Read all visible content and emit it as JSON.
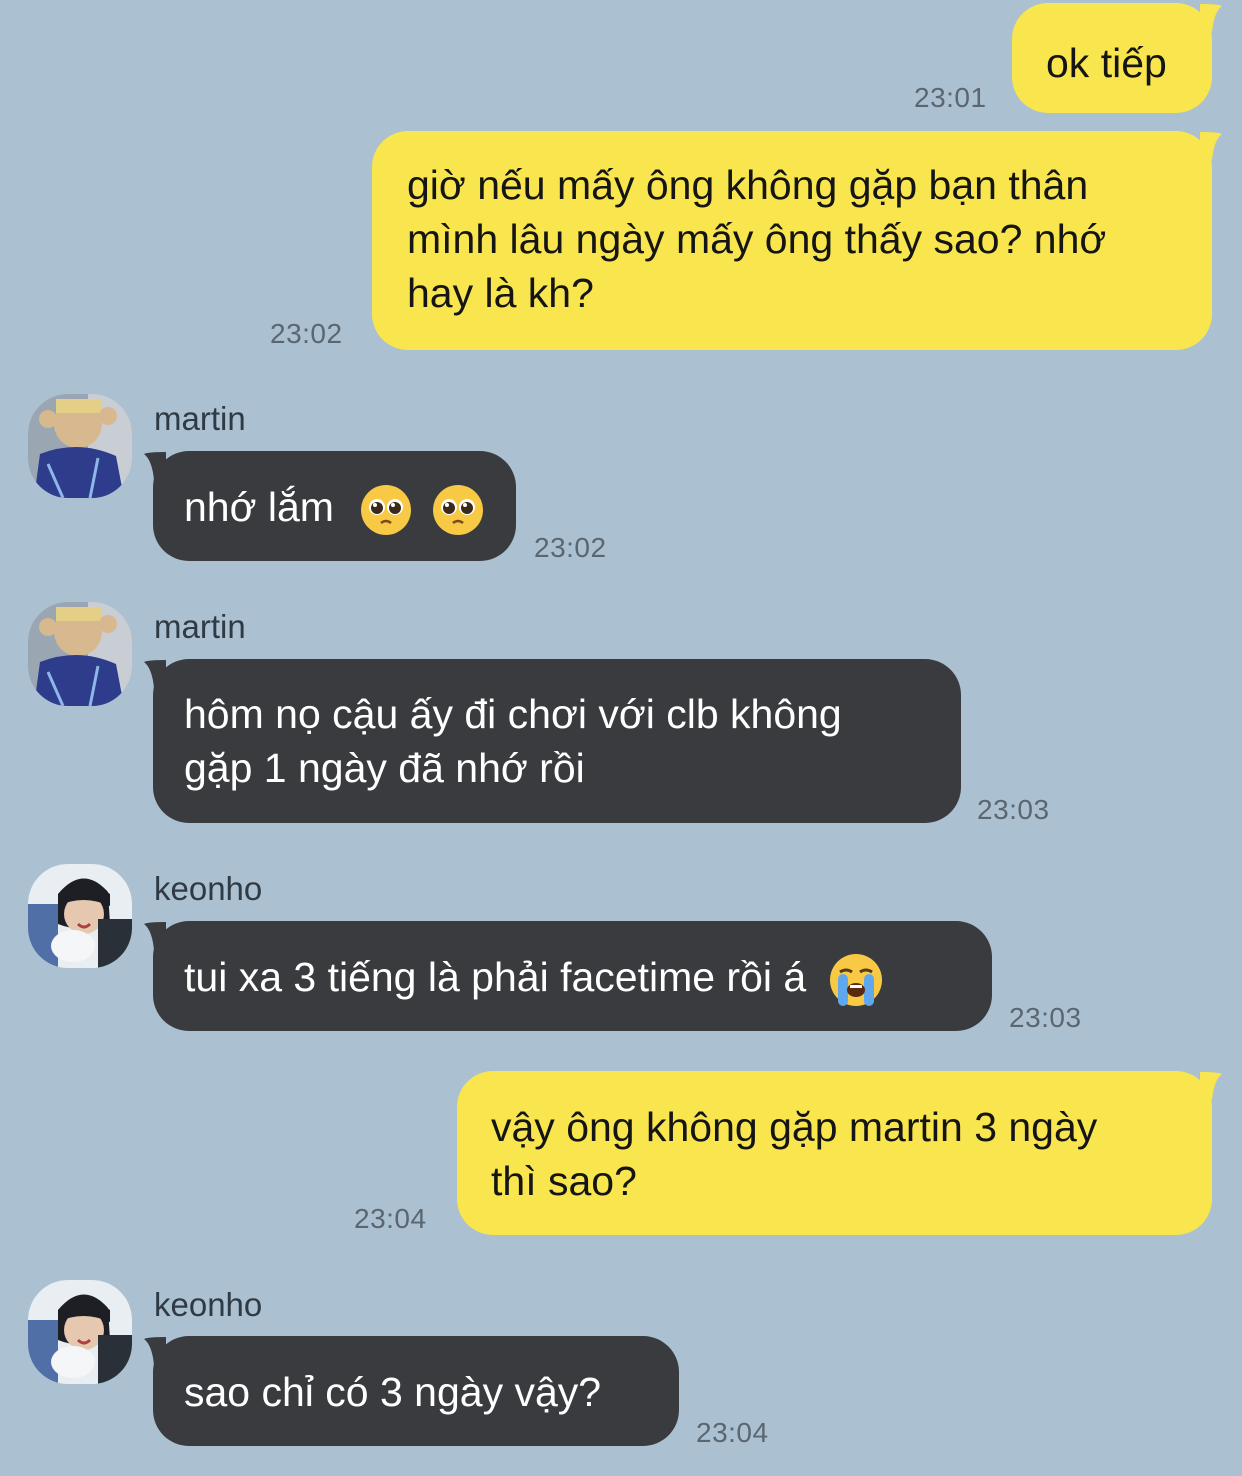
{
  "messages": [
    {
      "type": "outgoing",
      "text": "ok tiếp",
      "time": "23:01"
    },
    {
      "type": "outgoing",
      "text": "giờ nếu mấy ông không gặp bạn thân mình lâu ngày mấy ông thấy sao? nhớ hay là kh?",
      "line1": "giờ nếu mấy ông không gặp bạn thân",
      "line2": "mình lâu ngày mấy ông thấy sao? nhớ",
      "line3": "hay là kh?",
      "time": "23:02"
    },
    {
      "type": "incoming",
      "sender": "martin",
      "text": "nhớ lắm",
      "emoji": [
        "pleading-face",
        "pleading-face"
      ],
      "time": "23:02"
    },
    {
      "type": "incoming",
      "sender": "martin",
      "line1": "hôm nọ cậu ấy đi chơi với clb không",
      "line2": "gặp 1 ngày đã nhớ rồi",
      "time": "23:03"
    },
    {
      "type": "incoming",
      "sender": "keonho",
      "text": "tui xa 3 tiếng là phải facetime rồi á",
      "emoji": [
        "loudly-crying-face"
      ],
      "time": "23:03"
    },
    {
      "type": "outgoing",
      "line1": "vậy ông không gặp martin 3 ngày",
      "line2": "thì sao?",
      "time": "23:04"
    },
    {
      "type": "incoming",
      "sender": "keonho",
      "text": "sao chỉ có 3 ngày vậy?",
      "time": "23:04"
    }
  ],
  "colors": {
    "background": "#abc1d1",
    "outgoing_bubble": "#f9e64e",
    "incoming_bubble": "#3a3b3e",
    "timestamp": "#5b6670"
  }
}
